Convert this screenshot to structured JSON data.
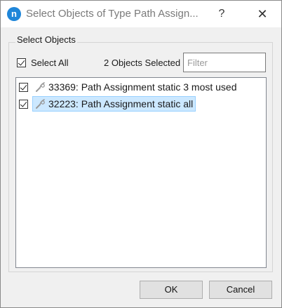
{
  "titlebar": {
    "app_icon_letter": "n",
    "title": "Select Objects of Type Path Assign...",
    "help_glyph": "?",
    "close_glyph": "✕"
  },
  "group": {
    "label": "Select Objects"
  },
  "select_all": {
    "label": "Select All",
    "checked": true
  },
  "selection_count": "2 Objects Selected",
  "filter": {
    "value": "",
    "placeholder": "Filter"
  },
  "items": [
    {
      "label": "33369: Path Assignment static 3 most used",
      "checked": true,
      "selected": false,
      "icon": "path-assignment-icon"
    },
    {
      "label": "32223: Path Assignment static all",
      "checked": true,
      "selected": true,
      "icon": "path-assignment-icon"
    }
  ],
  "buttons": {
    "ok": "OK",
    "cancel": "Cancel"
  },
  "colors": {
    "accent": "#1f86d9",
    "selection_bg": "#cce8ff",
    "selection_border": "#99d1ff"
  }
}
